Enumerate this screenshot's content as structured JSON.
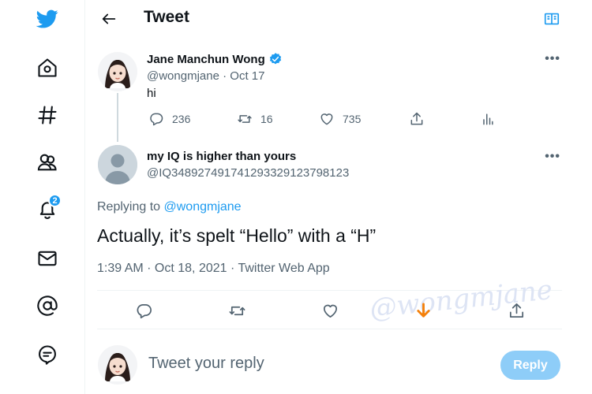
{
  "header": {
    "title": "Tweet"
  },
  "sidebar": {
    "notifications_badge": "2"
  },
  "original_tweet": {
    "name": "Jane Manchun Wong",
    "handle": "@wongmjane",
    "date": "· Oct 17",
    "text": "hi",
    "replies": "236",
    "retweets": "16",
    "likes": "735"
  },
  "reply_tweet": {
    "name": "my IQ is higher than yours",
    "handle": "@IQ348927491741293329123798123",
    "replying_prefix": "Replying to",
    "replying_handle": "@wongmjane",
    "text": "Actually, it’s spelt “Hello” with a “H”",
    "meta": "1:39 AM · Oct 18, 2021 · Twitter Web App"
  },
  "watermark": "@wongmjane",
  "composer": {
    "placeholder": "Tweet your reply",
    "button": "Reply"
  },
  "colors": {
    "accent": "#1d9bf0",
    "secondary": "#536471",
    "border": "#eff3f4",
    "highlight": "#f4800b"
  }
}
